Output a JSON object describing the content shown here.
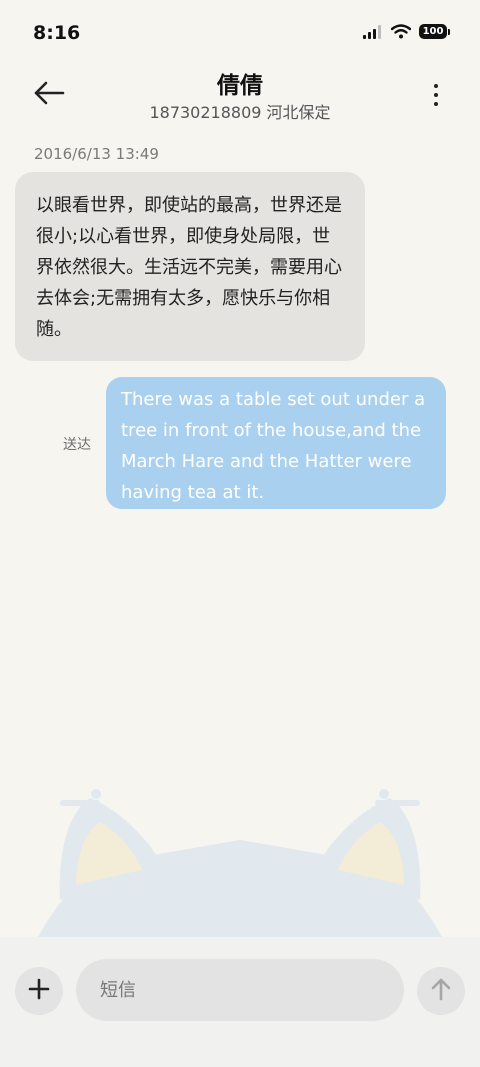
{
  "status_bar": {
    "time": "8:16",
    "battery": "100",
    "icons": [
      "signal-icon",
      "wifi-icon",
      "battery-icon"
    ]
  },
  "header": {
    "contact_name": "倩倩",
    "contact_detail": "18730218809 河北保定",
    "icons": [
      "back-arrow-icon",
      "more-vertical-icon"
    ]
  },
  "conversation": {
    "timestamp": "2016/6/13 13:49",
    "messages": [
      {
        "direction": "incoming",
        "text": "以眼看世界，即使站的最高，世界还是很小;以心看世界，即使身处局限，世界依然很大。生活远不完美，需要用心去体会;无需拥有太多，愿快乐与你相随。"
      },
      {
        "direction": "outgoing",
        "status": "送达",
        "text": "There was a table set out under a tree in front of the house,and the March Hare and the Hatter were having tea at it."
      }
    ]
  },
  "composer": {
    "placeholder": "短信",
    "icons": [
      "plus-icon",
      "send-arrow-icon"
    ]
  },
  "colors": {
    "background": "#f7f5f0",
    "incoming_bubble": "#e4e3e0",
    "outgoing_bubble": "#a9d1ef",
    "composer_bar": "#f1f1f0"
  }
}
